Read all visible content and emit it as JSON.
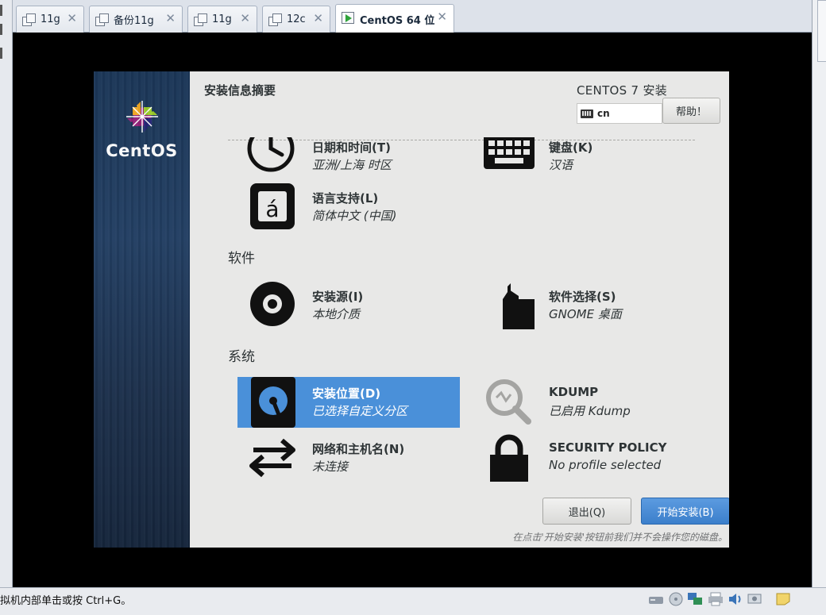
{
  "tabs": [
    {
      "label": "11g",
      "active": false
    },
    {
      "label": "备份11g",
      "active": false
    },
    {
      "label": "11g",
      "active": false
    },
    {
      "label": "12c",
      "active": false
    },
    {
      "label": "CentOS 64 位",
      "active": true
    }
  ],
  "installer": {
    "brand": "CentOS",
    "title": "安装信息摘要",
    "product": "CENTOS 7 安装",
    "keyboard_layout": "cn",
    "help_label": "帮助！",
    "sections": {
      "software": "软件",
      "system": "系统"
    },
    "spokes": {
      "datetime": {
        "name": "日期和时间(T)",
        "status": "亚洲/上海 时区"
      },
      "keyboard": {
        "name": "键盘(K)",
        "status": "汉语"
      },
      "language": {
        "name": "语言支持(L)",
        "status": "简体中文 (中国)"
      },
      "source": {
        "name": "安装源(I)",
        "status": "本地介质"
      },
      "software_selection": {
        "name": "软件选择(S)",
        "status": "GNOME 桌面"
      },
      "destination": {
        "name": "安装位置(D)",
        "status": "已选择自定义分区"
      },
      "kdump": {
        "name": "KDUMP",
        "status": "已启用 Kdump"
      },
      "network": {
        "name": "网络和主机名(N)",
        "status": "未连接"
      },
      "security": {
        "name": "SECURITY POLICY",
        "status": "No profile selected"
      }
    },
    "quit_label": "退出(Q)",
    "begin_label": "开始安装(B)",
    "warning": "在点击'开始安装'按钮前我们并不会操作您的磁盘。"
  },
  "statusbar": {
    "hint": "拟机内部单击或按 Ctrl+G。"
  },
  "colors": {
    "selected_spoke": "#4a90d9",
    "sidebar": "#1c3454",
    "installer_bg": "#e8e8e7"
  }
}
